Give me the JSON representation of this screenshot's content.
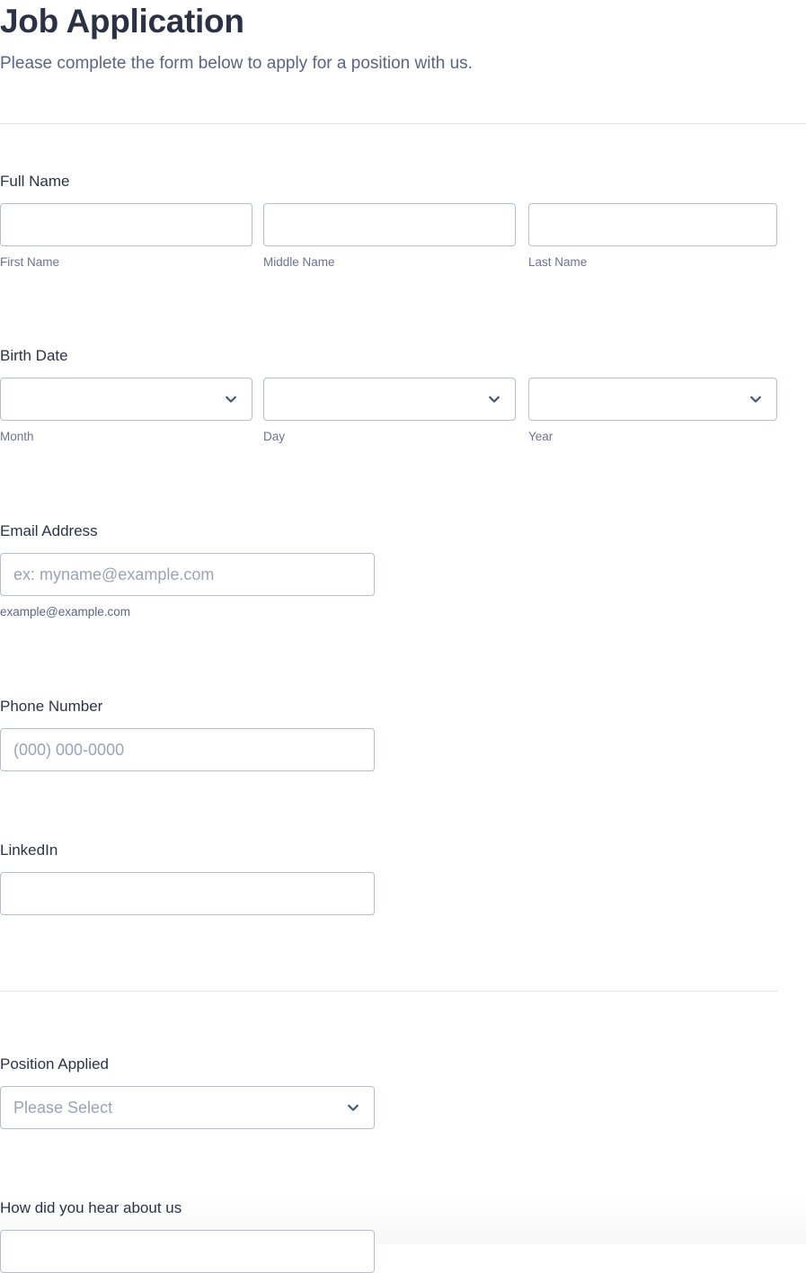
{
  "header": {
    "title": "Job Application",
    "subtitle": "Please complete the form below to apply for a position with us."
  },
  "fields": {
    "full_name": {
      "label": "Full Name",
      "parts": [
        {
          "sublabel": "First Name",
          "value": "",
          "placeholder": ""
        },
        {
          "sublabel": "Middle Name",
          "value": "",
          "placeholder": ""
        },
        {
          "sublabel": "Last Name",
          "value": "",
          "placeholder": ""
        }
      ]
    },
    "birth_date": {
      "label": "Birth Date",
      "parts": [
        {
          "sublabel": "Month",
          "value": "",
          "icon": "chevron-down-icon"
        },
        {
          "sublabel": "Day",
          "value": "",
          "icon": "chevron-down-icon"
        },
        {
          "sublabel": "Year",
          "value": "",
          "icon": "chevron-down-icon"
        }
      ]
    },
    "email": {
      "label": "Email Address",
      "placeholder": "ex: myname@example.com",
      "value": "",
      "hint": "example@example.com"
    },
    "phone": {
      "label": "Phone Number",
      "placeholder": "(000) 000-0000",
      "value": ""
    },
    "linkedin": {
      "label": "LinkedIn",
      "placeholder": "",
      "value": ""
    },
    "position_applied": {
      "label": "Position Applied",
      "value": "Please Select",
      "icon": "chevron-down-icon"
    },
    "how_did_you_hear": {
      "label": "How did you hear about us",
      "value": ""
    }
  },
  "colors": {
    "title": "#2b3245",
    "subtitle": "#5b6484",
    "label": "#2c3345",
    "sublabel": "#6b7391",
    "input_border": "#b7bdcf",
    "placeholder": "#9aa3b8",
    "chevron": "#4a5675",
    "divider_strong": "#dedee8",
    "divider_light": "#e7e7e9",
    "background": "#ffffff"
  }
}
